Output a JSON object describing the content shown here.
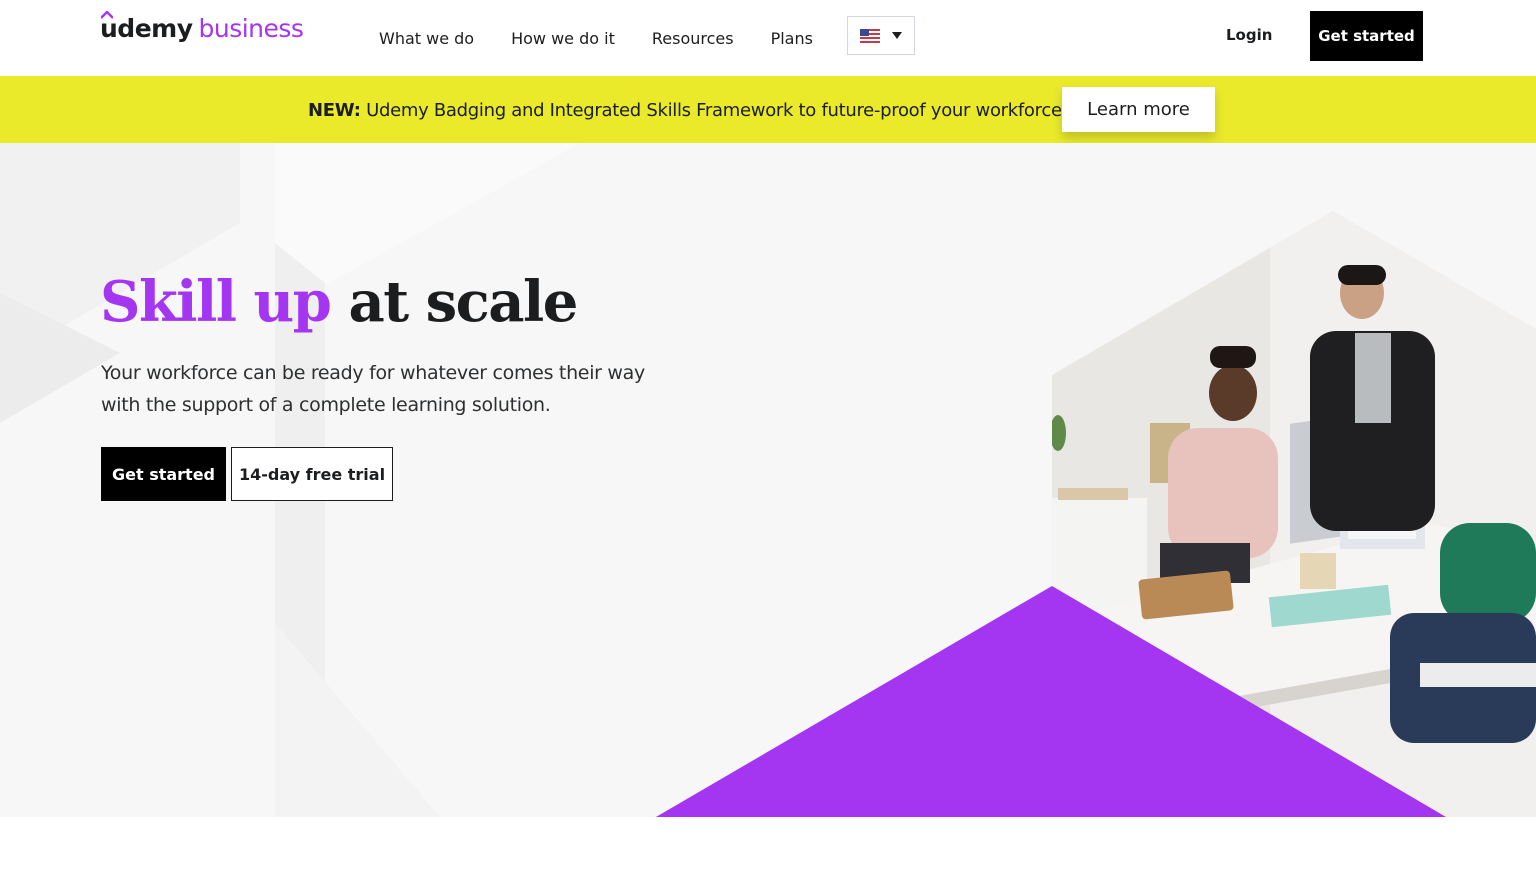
{
  "header": {
    "logo": {
      "brand": "udemy",
      "product": "business"
    },
    "nav": [
      {
        "label": "What we do"
      },
      {
        "label": "How we do it"
      },
      {
        "label": "Resources"
      },
      {
        "label": "Plans"
      }
    ],
    "language_select": {
      "icon": "us-flag-icon",
      "selected": "English (US)"
    },
    "login_label": "Login",
    "cta_label": "Get started"
  },
  "banner": {
    "prefix": "NEW:",
    "text": "Udemy Badging and Integrated Skills Framework to future-proof your workforce.",
    "button_label": "Learn more",
    "color": "#eaea2b"
  },
  "hero": {
    "title_accent": "Skill up",
    "title_rest": "at scale",
    "subtitle": "Your workforce can be ready for whatever comes their way with the support of a complete learning solution.",
    "primary_button": "Get started",
    "secondary_button": "14-day free trial",
    "image": "office-coworkers-at-desk-photo"
  },
  "colors": {
    "accent": "#a435f0",
    "dark": "#1c1d1f",
    "banner": "#eaea2b",
    "hero_bg": "#f7f7f7"
  }
}
